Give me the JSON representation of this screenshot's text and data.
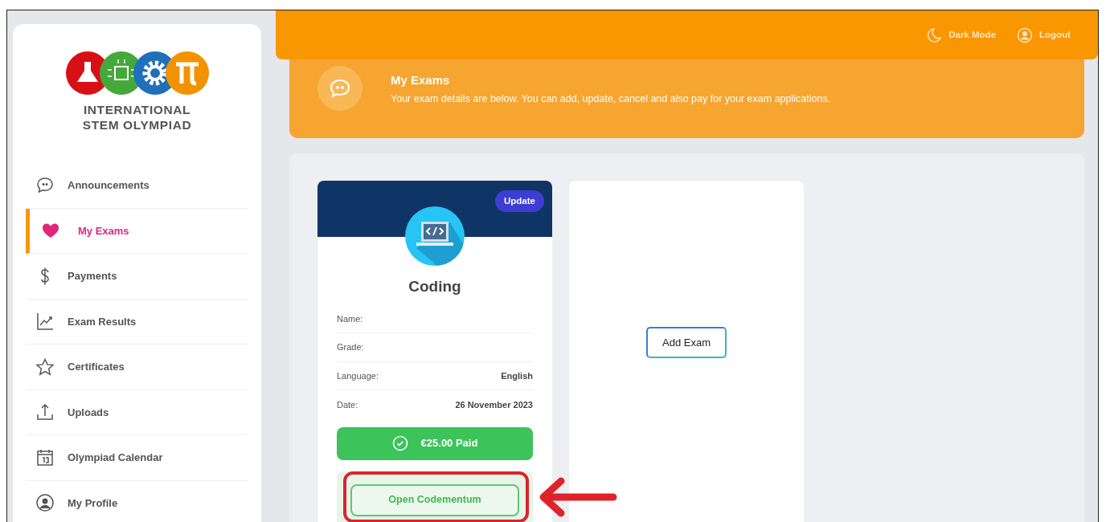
{
  "topbar": {
    "actions": [
      {
        "label": "Dark Mode"
      },
      {
        "label": "Logout"
      }
    ]
  },
  "brand": {
    "lines": [
      "INTERNATIONAL",
      "STEM OLYMPIAD"
    ]
  },
  "sidebar": {
    "items": [
      {
        "label": "Announcements",
        "selected": false
      },
      {
        "label": "My Exams",
        "selected": true
      },
      {
        "label": "Payments",
        "selected": false
      },
      {
        "label": "Exam Results",
        "selected": false
      },
      {
        "label": "Certificates",
        "selected": false
      },
      {
        "label": "Uploads",
        "selected": false
      },
      {
        "label": "Olympiad Calendar",
        "selected": false
      },
      {
        "label": "My Profile",
        "selected": false
      }
    ]
  },
  "banner": {
    "title": "My Exams",
    "subtitle": "Your exam details are below. You can add, update, cancel and also pay for your exam applications."
  },
  "exams": [
    {
      "update_button": "Update",
      "subject": "Coding",
      "fields": [
        {
          "label": "Name:"
        },
        {
          "label": "Grade:"
        },
        {
          "label": "Language:",
          "value": "English"
        },
        {
          "label": "Date:",
          "value": "26 November 2023"
        }
      ],
      "payment": {
        "label": "€25.00 Paid",
        "paid": true
      },
      "action_button": "Open Codementum",
      "highlighted": true
    }
  ],
  "add_exam_button": "Add Exam"
}
